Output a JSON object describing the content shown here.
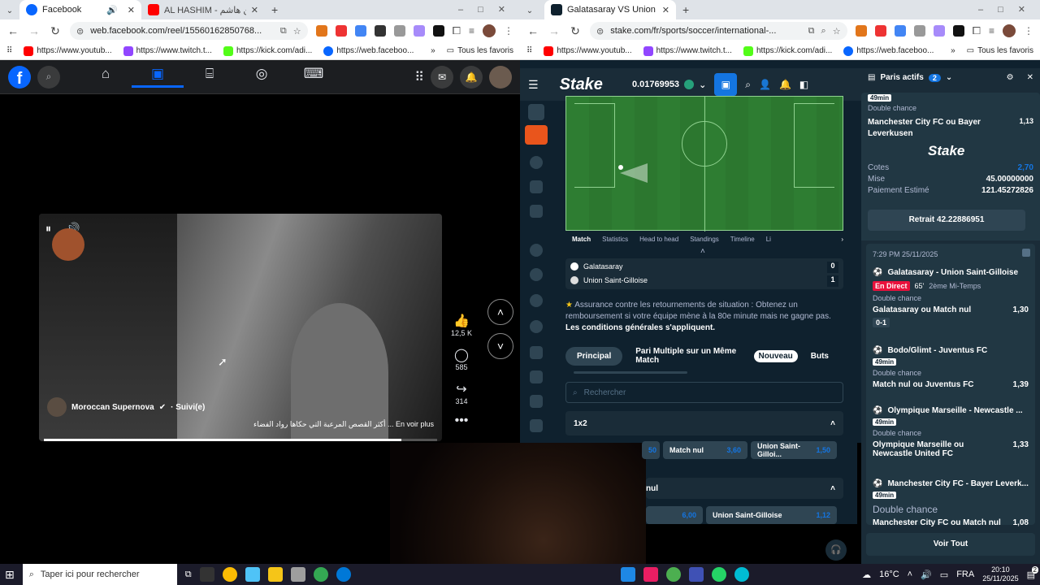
{
  "left_browser": {
    "tabs": [
      {
        "label": "Facebook",
        "active": true
      },
      {
        "label": "AL HASHIM - حسين هاشم - YouT...",
        "active": false
      }
    ],
    "new_tab": "+",
    "url": "web.facebook.com/reel/15560162850768...",
    "bookmarks": [
      "https://www.youtub...",
      "https://www.twitch.t...",
      "https://kick.com/adi...",
      "https://web.faceboo..."
    ],
    "bookmarks_more": "»",
    "bookmarks_folder": "Tous les favoris"
  },
  "facebook": {
    "video": {
      "author": "Moroccan Supernova",
      "author_suffix": "· Suivi(e)",
      "caption": "أكثر القصص المرعبة التي حكاها رواد الفضاء ... En voir plus"
    },
    "actions": [
      {
        "name": "like",
        "count": "12,5 K"
      },
      {
        "name": "comment",
        "count": "585"
      },
      {
        "name": "share",
        "count": "314"
      }
    ]
  },
  "right_browser": {
    "tab_title": "Galatasaray VS Union Saint-Gill...",
    "new_tab": "+",
    "url": "stake.com/fr/sports/soccer/international-...",
    "bookmarks": [
      "https://www.youtub...",
      "https://www.twitch.t...",
      "https://kick.com/adi...",
      "https://web.faceboo..."
    ],
    "bookmarks_more": "»",
    "bookmarks_folder": "Tous les favoris"
  },
  "stake": {
    "logo": "Stake",
    "balance": "0.01769953",
    "match_tabs": [
      "Match",
      "Statistics",
      "Head to head",
      "Standings",
      "Timeline",
      "Li"
    ],
    "teams": [
      {
        "name": "Galatasaray",
        "score": "0"
      },
      {
        "name": "Union Saint-Gilloise",
        "score": "1"
      }
    ],
    "insurance": "Assurance contre les retournements de situation : Obtenez un remboursement si votre équipe mène à la 80e minute mais ne gagne pas.",
    "insurance_terms": "Les conditions générales s'appliquent.",
    "market_tabs": {
      "principal": "Principal",
      "pari": "Pari Multiple sur un Même Match",
      "nouveau": "Nouveau",
      "buts": "Buts"
    },
    "search_placeholder": "Rechercher",
    "market_1x2": "1x2",
    "odds_row1": [
      {
        "label": "",
        "value": "50"
      },
      {
        "label": "Match nul",
        "value": "3,60"
      },
      {
        "label": "Union Saint-Gilloi...",
        "value": "1,50"
      }
    ],
    "market_2": "nul",
    "odds_row2": [
      {
        "label": "",
        "value": "6,00"
      },
      {
        "label": "Union Saint-Gilloise",
        "value": "1,12"
      }
    ]
  },
  "betslip": {
    "title": "Paris actifs",
    "count": "2",
    "top_bet": {
      "minute": "49min",
      "type": "Double chance",
      "selection": "Manchester City FC ou Bayer Leverkusen",
      "odds": "1,13"
    },
    "stake_logo": "Stake",
    "summary": [
      {
        "label": "Cotes",
        "value": "2,70"
      },
      {
        "label": "Mise",
        "value": "45.00000000"
      },
      {
        "label": "Paiement Estimé",
        "value": "121.45272826"
      }
    ],
    "cashout": "Retrait 42.22886951",
    "second_bet": {
      "time": "7:29 PM 25/11/2025",
      "legs": [
        {
          "match": "Galatasaray - Union Saint-Gilloise",
          "live": "En Direct",
          "minute": "65'",
          "period": "2ème Mi-Temps",
          "type": "Double chance",
          "selection": "Galatasaray ou Match nul",
          "odds": "1,30",
          "score": "0-1"
        },
        {
          "match": "Bodo/Glimt - Juventus FC",
          "minute": "49min",
          "type": "Double chance",
          "selection": "Match nul ou Juventus FC",
          "odds": "1,39"
        },
        {
          "match": "Olympique Marseille - Newcastle ...",
          "minute": "49min",
          "type": "Double chance",
          "selection": "Olympique Marseille ou Newcastle United FC",
          "odds": "1,33"
        },
        {
          "match": "Manchester City FC - Bayer Leverk...",
          "minute": "49min",
          "type": "Double chance",
          "selection": "Manchester City FC ou Match nul",
          "odds": "1,08"
        }
      ]
    },
    "view_all": "Voir Tout"
  },
  "taskbar": {
    "search_placeholder": "Taper ici pour rechercher",
    "weather": "16°C",
    "language": "FRA",
    "time": "20:10",
    "date": "25/11/2025",
    "notifications": "2"
  },
  "colors": {
    "fb_blue": "#0866ff",
    "stake_bg": "#0f212e",
    "stake_panel": "#1a2c38",
    "stake_green": "#00e701",
    "stake_blue": "#1475e1"
  }
}
